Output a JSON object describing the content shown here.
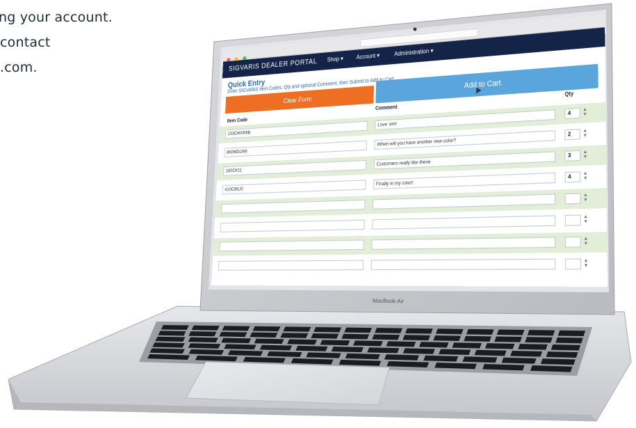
{
  "marketing_copy": {
    "lines": [
      "ng your account.",
      "contact",
      ".com."
    ]
  },
  "device": {
    "label": "MacBook Air"
  },
  "browser": {
    "traffic_lights": [
      "#f25f58",
      "#fbbe2f",
      "#3fc43f"
    ]
  },
  "portal": {
    "brand": "SIGVARIS DEALER PORTAL",
    "nav": [
      "Shop ▾",
      "Account ▾",
      "Administration ▾"
    ],
    "quick_entry_title": "Quick Entry",
    "quick_entry_instructions": "Enter SIGVARIS Item Codes, Qty and optional Comment, then Submit to Add to Cart.",
    "clear_button": "Clear Form",
    "add_button": "Add to Cart",
    "columns": {
      "item_code": "Item Code",
      "comment": "Comment",
      "qty": "Qty"
    },
    "rows": [
      {
        "item_code": "233CMXR6B",
        "comment": "Love ’em!",
        "qty": "4"
      },
      {
        "item_code": "860MDLW8",
        "comment": "When will you have another new color?",
        "qty": "2"
      },
      {
        "item_code": "180CK11",
        "comment": "Customers really like these",
        "qty": "3"
      },
      {
        "item_code": "410CMLI0",
        "comment": "Finally in my color!",
        "qty": "4"
      },
      {
        "item_code": "",
        "comment": "",
        "qty": ""
      },
      {
        "item_code": "",
        "comment": "",
        "qty": ""
      },
      {
        "item_code": "",
        "comment": "",
        "qty": ""
      },
      {
        "item_code": "",
        "comment": "",
        "qty": ""
      }
    ]
  },
  "colors": {
    "nav_bg": "#142448",
    "clear_button": "#ee6e24",
    "add_button": "#5aa6dc",
    "row_alt": "#e2eed8",
    "link_blue": "#2a67a6"
  }
}
